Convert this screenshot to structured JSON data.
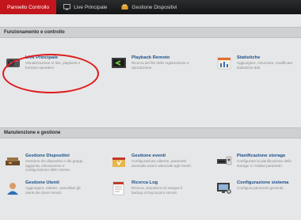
{
  "tabs": [
    {
      "label": "Pannello Controllo",
      "icon": "",
      "active": true
    },
    {
      "label": "Live Principale",
      "icon": "monitor-icon",
      "active": false
    },
    {
      "label": "Gestione Dispositivi",
      "icon": "device-manager-icon",
      "active": false
    }
  ],
  "sections": {
    "operation": {
      "title": "Funzionamento e controllo"
    },
    "maintenance": {
      "title": "Manutenzione e gestione"
    }
  },
  "operation_items": [
    {
      "title": "Live Principale",
      "desc": "Visualizzazione in live, playback e funzioni operative.",
      "icon": "camera-icon"
    },
    {
      "title": "Playback Remoto",
      "desc": "Ricerca dei file delle registrazione e riproduzione.",
      "icon": "playback-icon"
    },
    {
      "title": "Statistiche",
      "desc": "Aggiungere, rimuovere, modificare statistiche dati.",
      "icon": "statistics-icon"
    }
  ],
  "maintenance_items": [
    {
      "title": "Gestione Dispositivi",
      "desc": "Gestione dei dispositivi e dei gruppi, aggiunta, eliminazione e configurazione delle risorse.",
      "icon": "device-management-icon"
    },
    {
      "title": "Gestione eventi",
      "desc": "Configurazione allarme, parametri anomalie azioni associate agli eventi.",
      "icon": "event-management-icon"
    },
    {
      "title": "Pianificazione storage",
      "desc": "Configurare la pianificazione dello storage o i relativi parametri.",
      "icon": "storage-icon"
    },
    {
      "title": "Gestione Utenti",
      "desc": "Aggiungere, editare, cancellare gli utenti dei client remoti.",
      "icon": "user-management-icon"
    },
    {
      "title": "Ricerca Log",
      "desc": "Ricerca, visualizza ed esegue il backup di log locali e remoti.",
      "icon": "log-search-icon"
    },
    {
      "title": "Configurazione sistema",
      "desc": "Configura parametri generali.",
      "icon": "system-config-icon"
    }
  ]
}
